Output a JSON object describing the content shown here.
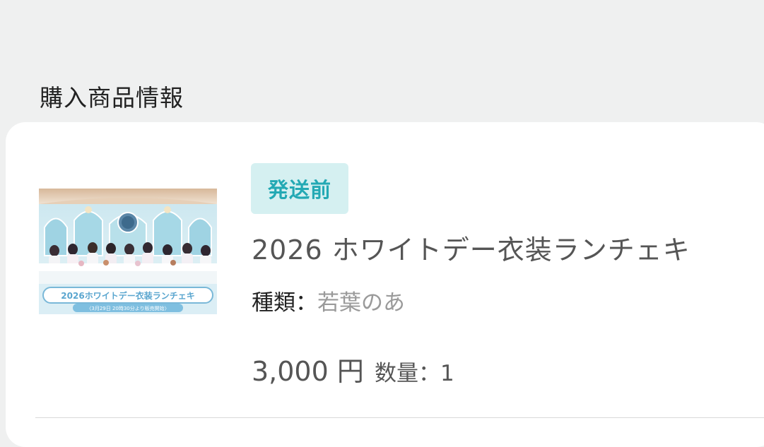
{
  "section": {
    "title": "購入商品情報"
  },
  "order_item": {
    "status_badge": "発送前",
    "product_name": "2026 ホワイトデー衣装ランチェキ",
    "variant_label": "種類：",
    "variant_value": "若葉のあ",
    "price": "3,000 円",
    "quantity_label": "数量：",
    "quantity_value": "1",
    "thumbnail": {
      "overlay_line1": "2026ホワイトデー衣装ランチェキ",
      "overlay_line2": "〈3月29日 20時30分より販売開始〉"
    }
  },
  "colors": {
    "page_background": "#eff0f0",
    "badge_background": "#d5f0f1",
    "badge_text": "#23a9b4"
  }
}
